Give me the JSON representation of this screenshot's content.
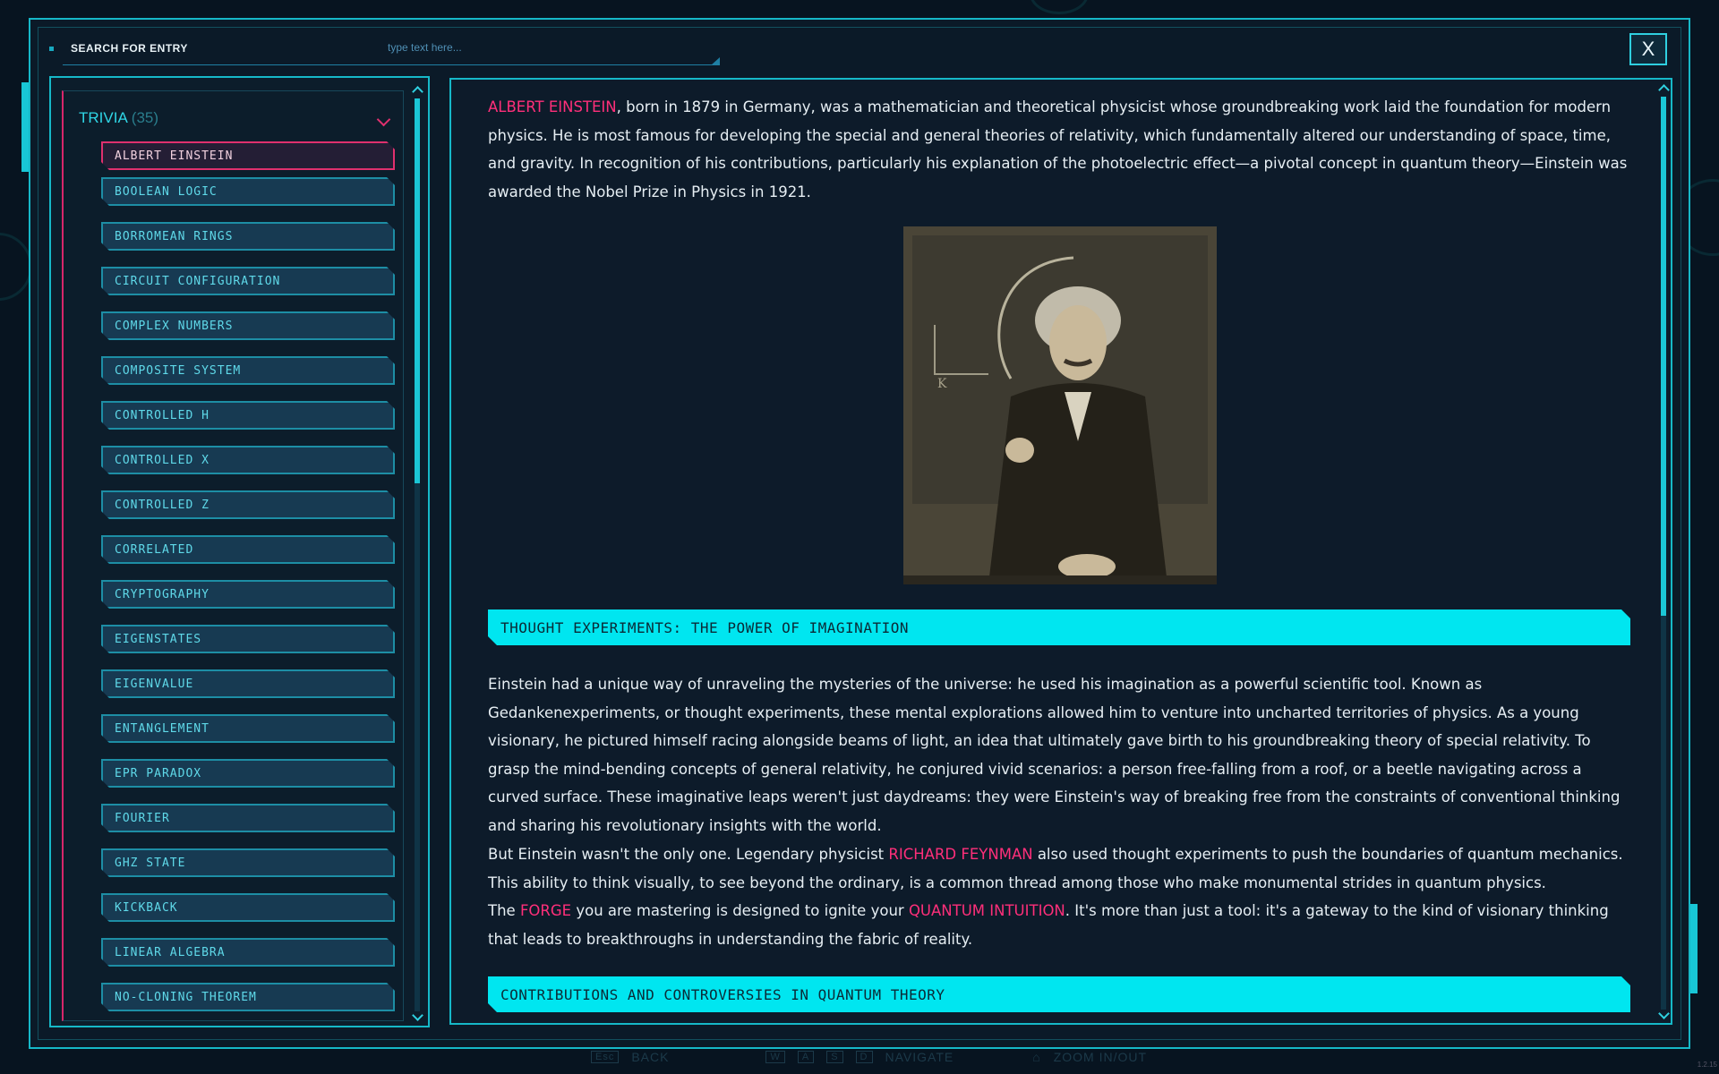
{
  "search": {
    "label": "SEARCH FOR ENTRY",
    "placeholder": "type text here..."
  },
  "close_label": "X",
  "sidebar": {
    "category": "TRIVIA",
    "count": "(35)",
    "items": [
      "ALBERT EINSTEIN",
      "BOOLEAN LOGIC",
      "BORROMEAN RINGS",
      "CIRCUIT CONFIGURATION",
      "COMPLEX NUMBERS",
      "COMPOSITE SYSTEM",
      "CONTROLLED H",
      "CONTROLLED X",
      "CONTROLLED Z",
      "CORRELATED",
      "CRYPTOGRAPHY",
      "EIGENSTATES",
      "EIGENVALUE",
      "ENTANGLEMENT",
      "EPR PARADOX",
      "FOURIER",
      "GHZ STATE",
      "KICKBACK",
      "LINEAR ALGEBRA",
      "NO-CLONING THEOREM"
    ],
    "active_index": 0
  },
  "article": {
    "intro": {
      "name": "ALBERT EINSTEIN",
      "text": ", born in 1879 in Germany, was a mathematician and theoretical physicist whose groundbreaking work laid the foundation for modern physics. He is most famous for developing the special and general theories of relativity, which fundamentally altered our understanding of space, time, and gravity. In recognition of his contributions, particularly his explanation of the photoelectric effect—a pivotal concept in quantum theory—Einstein was awarded the Nobel Prize in Physics in 1921."
    },
    "section1_title": "THOUGHT EXPERIMENTS: THE POWER OF IMAGINATION",
    "section1_p1": "Einstein had a unique way of unraveling the mysteries of the universe: he used his imagination as a powerful scientific tool. Known as Gedankenexperiments, or thought experiments, these mental explorations allowed him to venture into uncharted territories of physics. As a young visionary, he pictured himself racing alongside beams of light, an idea that ultimately gave birth to his groundbreaking theory of special relativity. To grasp the mind-bending concepts of general relativity, he conjured vivid scenarios: a person free-falling from a roof, or a beetle navigating across a curved surface. These imaginative leaps weren't just daydreams: they were Einstein's way of breaking free from the constraints of conventional thinking and sharing his revolutionary insights with the world.",
    "section1_p2_a": "But Einstein wasn't the only one. Legendary physicist ",
    "section1_p2_hl": "RICHARD FEYNMAN",
    "section1_p2_b": " also used thought experiments to push the boundaries of quantum mechanics. This ability to think visually, to see beyond the ordinary, is a common thread among those who make monumental strides in quantum physics.",
    "section1_p3_a": "The ",
    "section1_p3_hl1": "FORGE",
    "section1_p3_b": " you are mastering is designed to ignite your ",
    "section1_p3_hl2": "QUANTUM INTUITION",
    "section1_p3_c": ". It's more than just a tool: it's a gateway to the kind of visionary thinking that leads to breakthroughs in understanding the fabric of reality.",
    "section2_title": "CONTRIBUTIONS AND CONTROVERSIES IN QUANTUM THEORY"
  },
  "footer": {
    "back_key": "Esc",
    "back": "BACK",
    "nav_keys": [
      "W",
      "A",
      "S",
      "D"
    ],
    "navigate": "NAVIGATE",
    "zoom": "ZOOM IN/OUT"
  },
  "version": "1.2.15",
  "colors": {
    "accent": "#16b8c8",
    "highlight": "#ff2f7a",
    "section_header": "#00e6f0"
  }
}
